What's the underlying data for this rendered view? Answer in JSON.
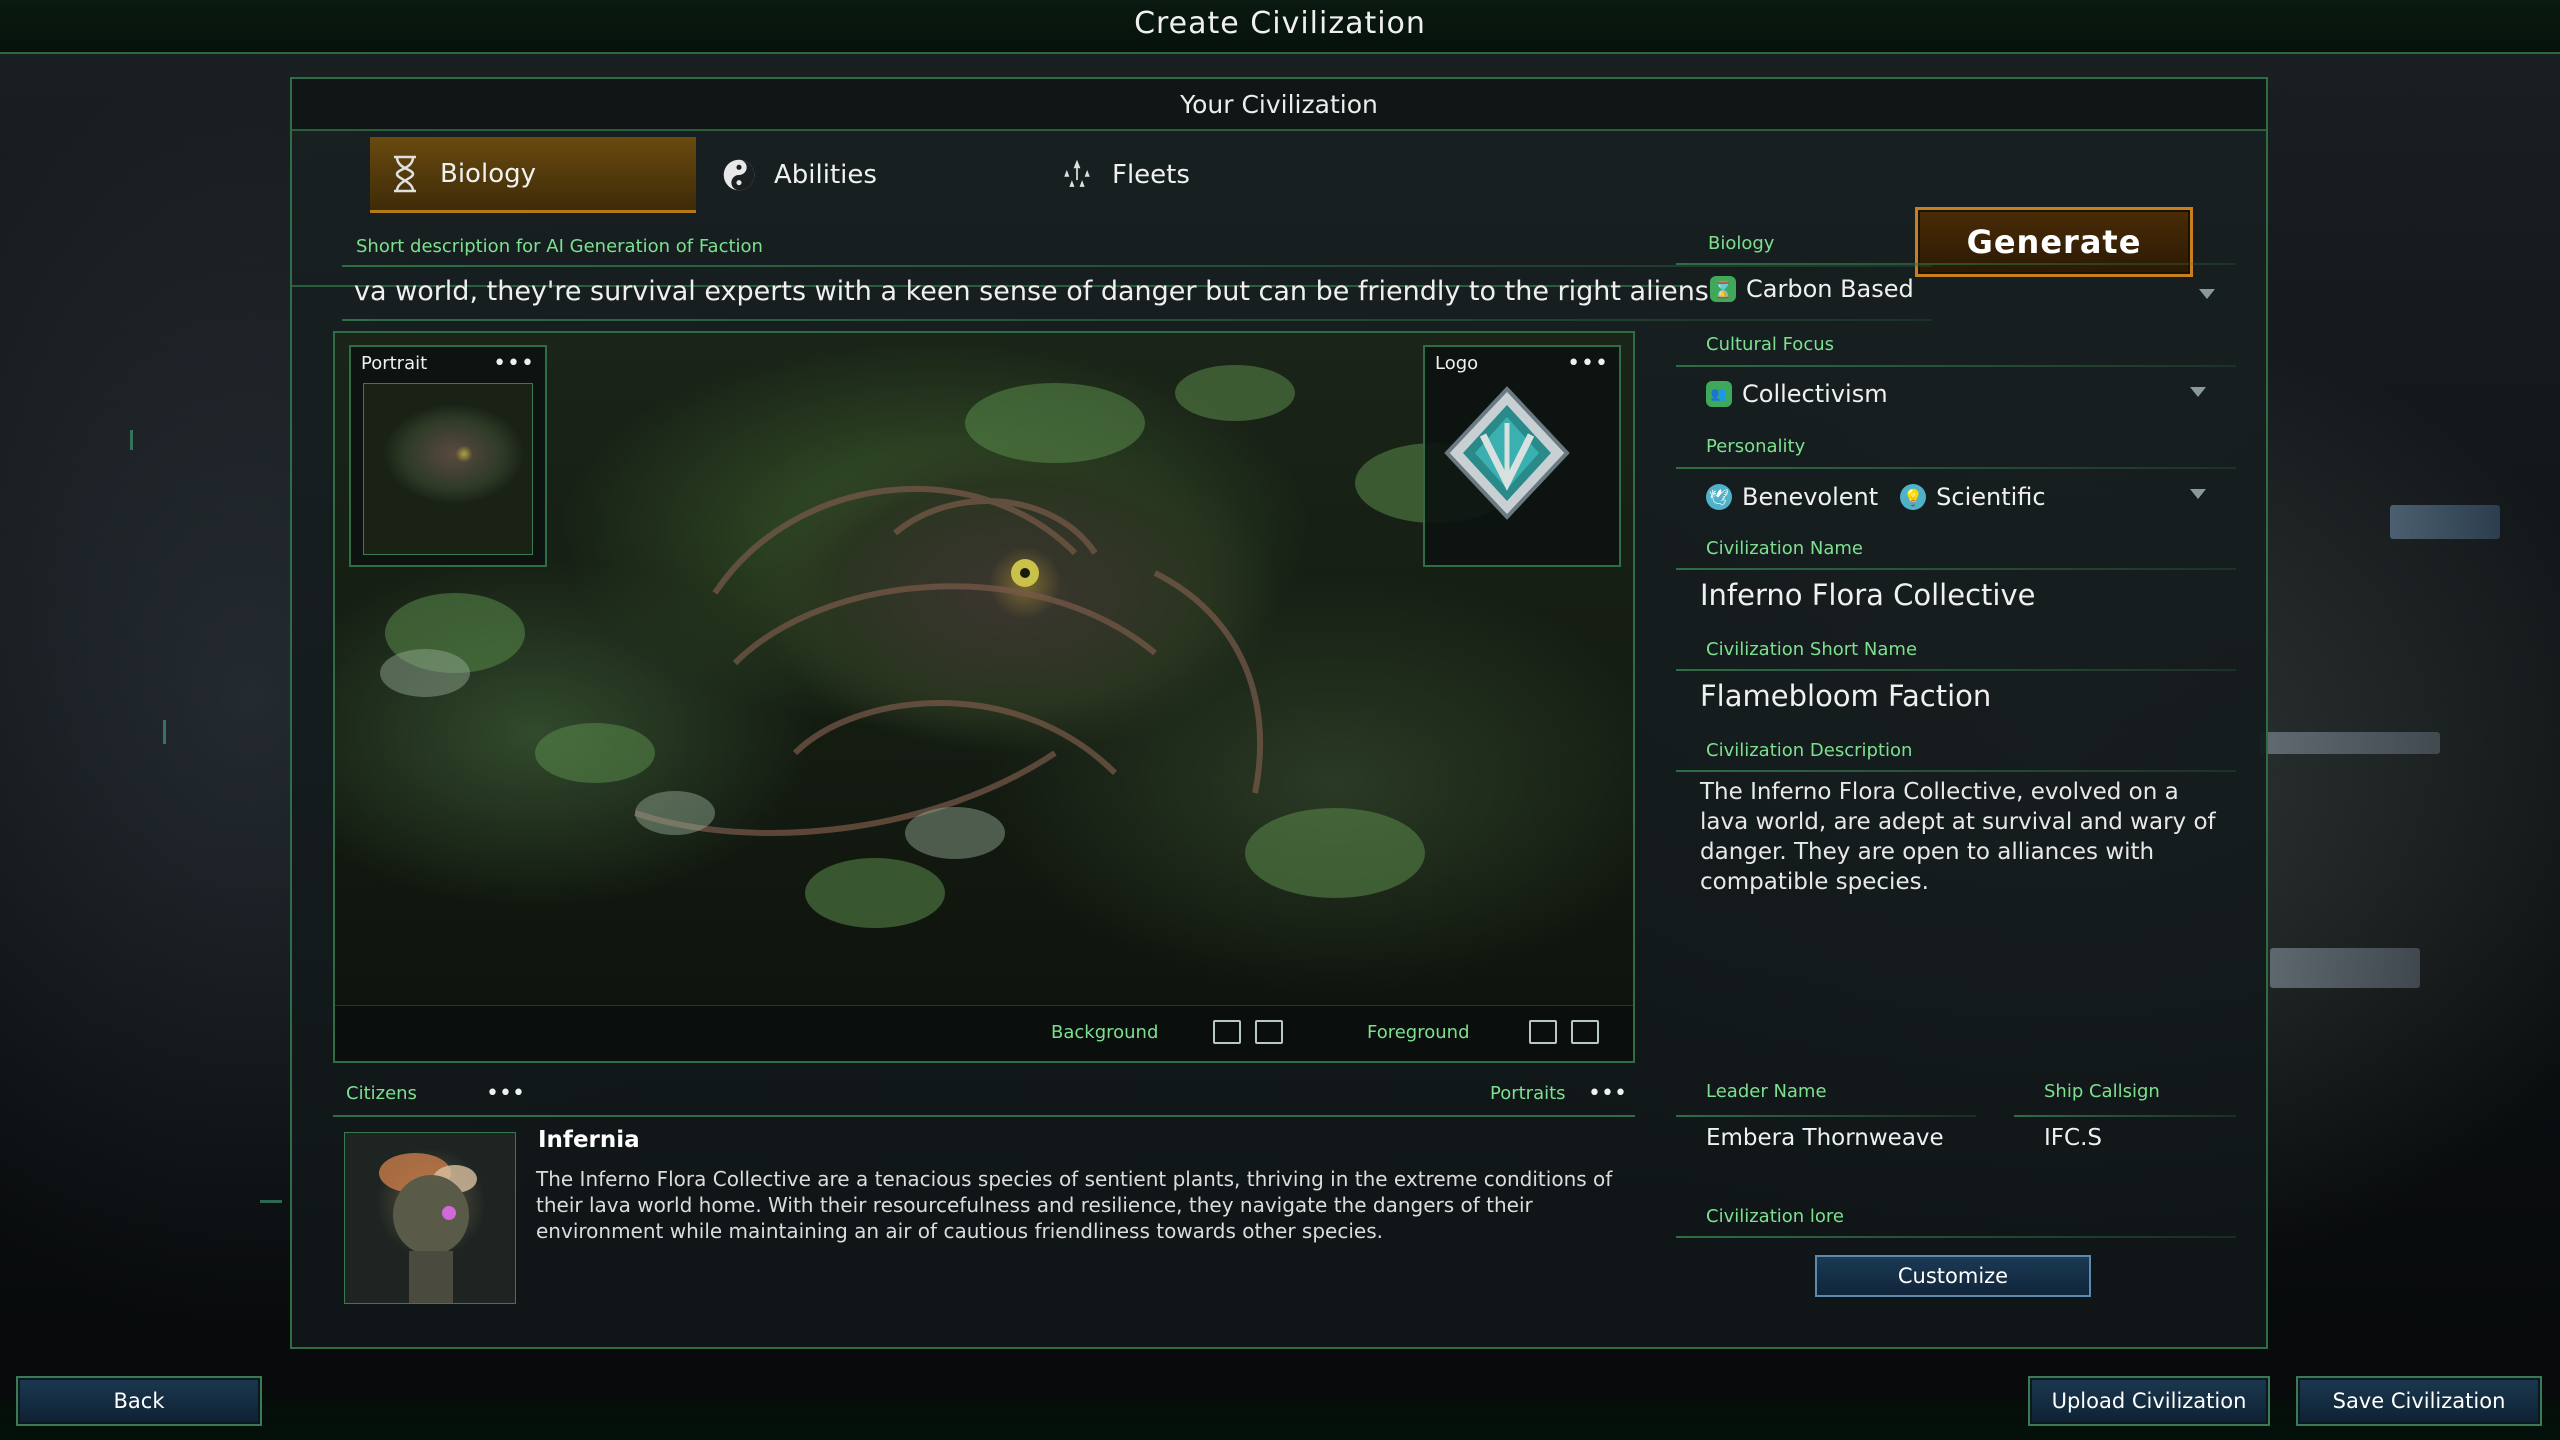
{
  "window": {
    "title": "Create Civilization"
  },
  "panel": {
    "title": "Your Civilization"
  },
  "tabs": [
    {
      "label": "Biology",
      "icon": "dna-icon",
      "active": true
    },
    {
      "label": "Abilities",
      "icon": "yin-yang-icon",
      "active": false
    },
    {
      "label": "Fleets",
      "icon": "fleet-icon",
      "active": false
    }
  ],
  "generate": {
    "label": "Generate"
  },
  "short_description": {
    "label": "Short description for AI Generation of Faction",
    "value": "va world, they're survival experts with a keen sense of danger but can be friendly to the right aliens"
  },
  "portrait": {
    "label": "Portrait",
    "menu": "•••"
  },
  "logo": {
    "label": "Logo",
    "menu": "•••"
  },
  "hero_footer": {
    "background_label": "Background",
    "foreground_label": "Foreground"
  },
  "form": {
    "biology": {
      "label": "Biology",
      "value": "Carbon Based",
      "icon": "hourglass-icon"
    },
    "cultural_focus": {
      "label": "Cultural Focus",
      "value": "Collectivism",
      "icon": "people-icon"
    },
    "personality": {
      "label": "Personality",
      "values": [
        {
          "value": "Benevolent",
          "icon": "dove-icon"
        },
        {
          "value": "Scientific",
          "icon": "lightbulb-icon"
        }
      ]
    },
    "civ_name": {
      "label": "Civilization Name",
      "value": "Inferno Flora Collective"
    },
    "civ_short_name": {
      "label": "Civilization Short Name",
      "value": "Flamebloom Faction"
    },
    "civ_description": {
      "label": "Civilization Description",
      "value": "The Inferno Flora Collective, evolved on a lava world, are adept at survival and wary of danger. They are open to alliances with compatible species."
    },
    "leader_name": {
      "label": "Leader Name",
      "value": "Embera Thornweave"
    },
    "ship_callsign": {
      "label": "Ship Callsign",
      "value": "IFC.S"
    },
    "civ_lore": {
      "label": "Civilization lore"
    },
    "customize": {
      "label": "Customize"
    }
  },
  "citizens": {
    "label": "Citizens",
    "menu": "•••",
    "portraits_label": "Portraits",
    "portraits_menu": "•••",
    "name": "Infernia",
    "description": "The Inferno Flora Collective are a tenacious species of sentient plants, thriving in the extreme conditions of their lava world home. With their resourcefulness and resilience, they navigate the dangers of their environment while maintaining an air of cautious friendliness towards other species."
  },
  "bottom": {
    "back": "Back",
    "upload": "Upload Civilization",
    "save": "Save Civilization"
  },
  "colors": {
    "accent_green": "#7de08f",
    "frame_green": "#2f6e45",
    "generate_orange": "#c8801e",
    "button_blue": "#1b3850"
  }
}
